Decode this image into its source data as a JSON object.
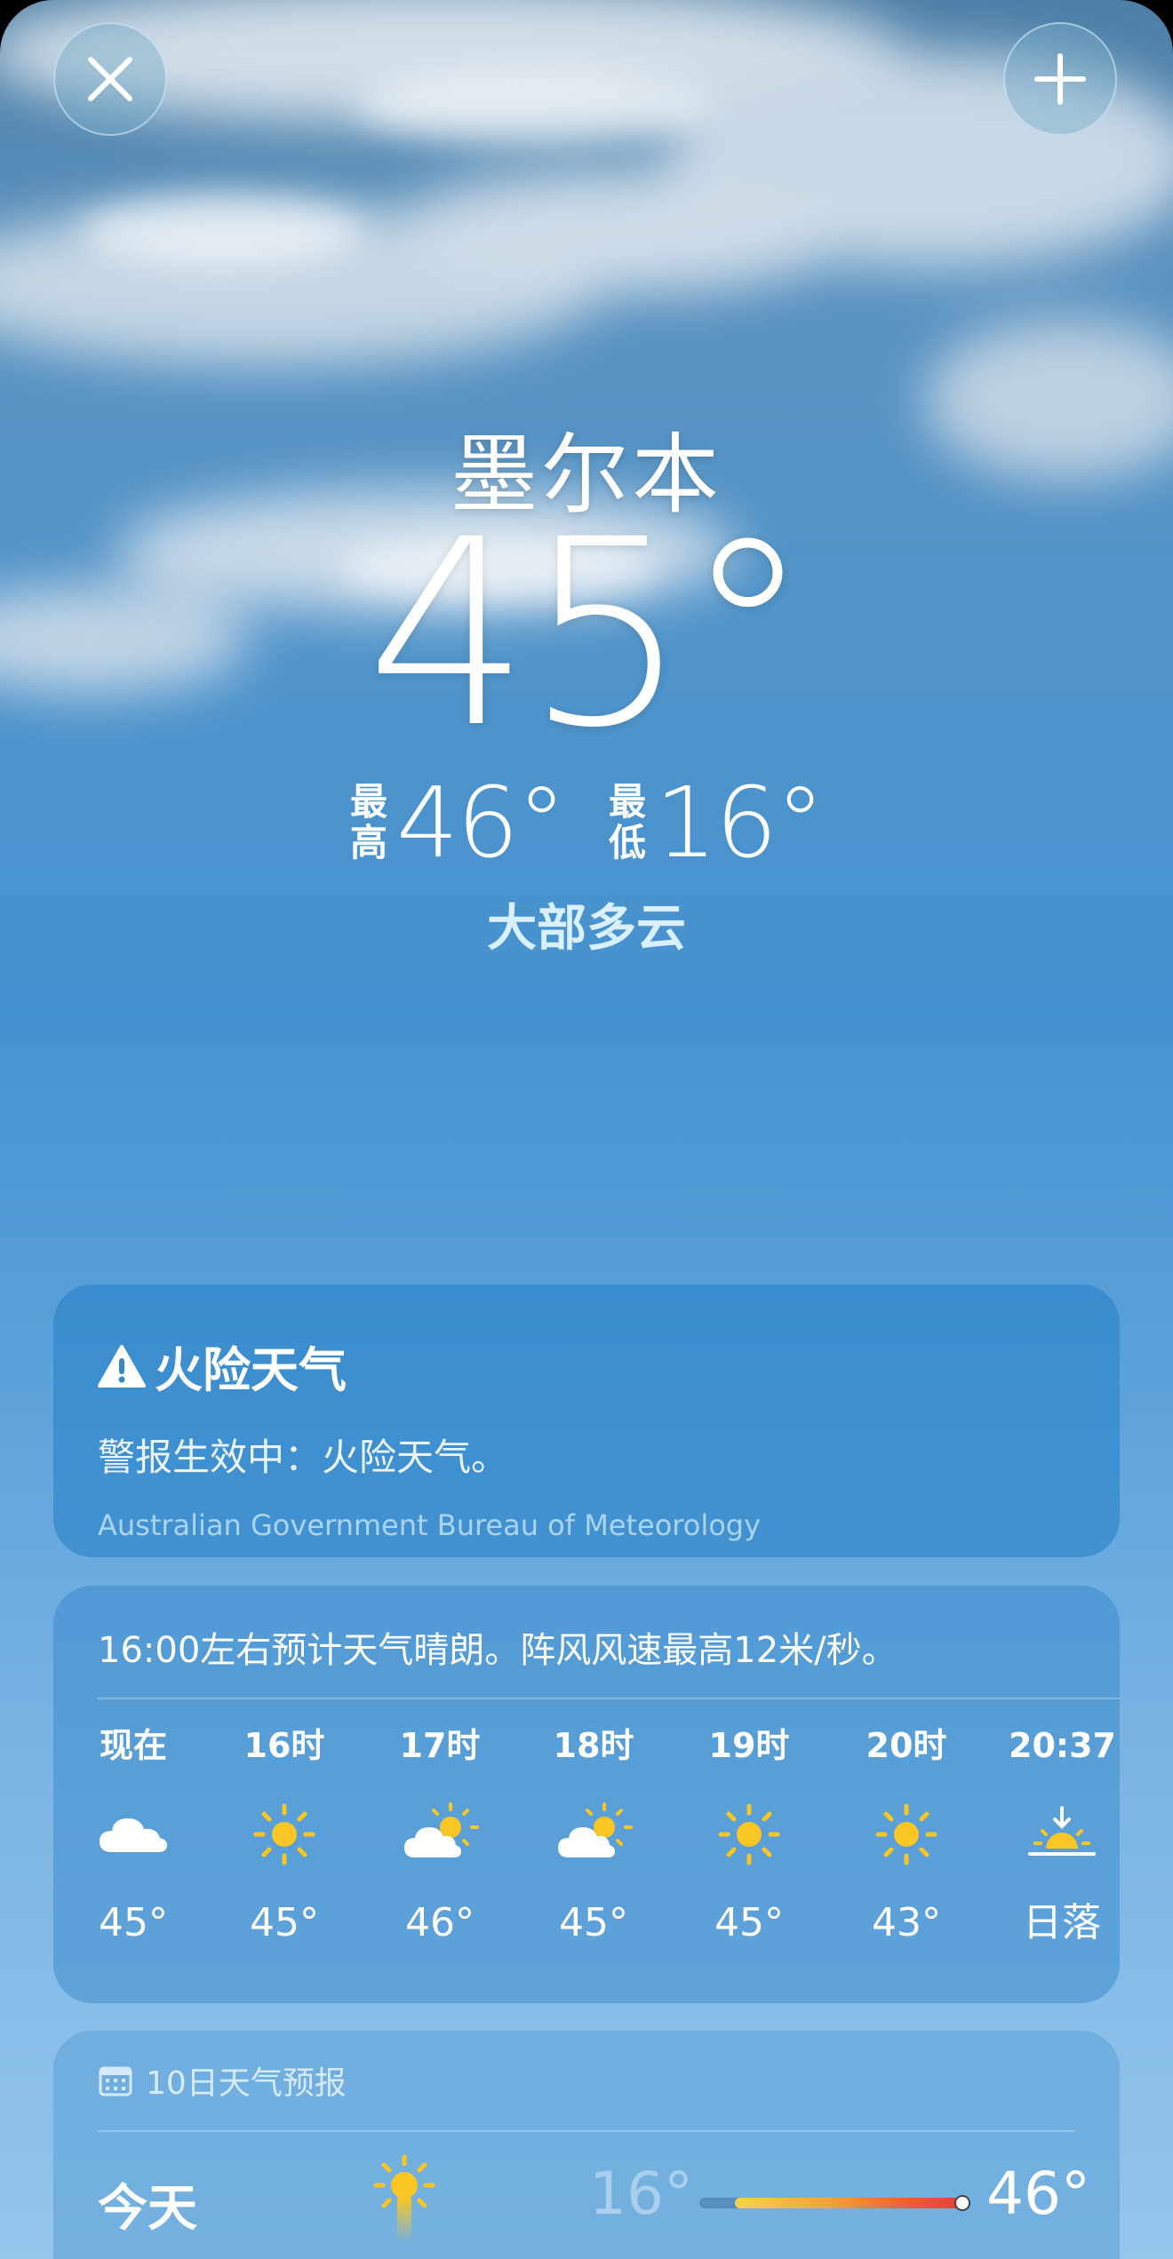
{
  "header": {
    "close_icon": "close-icon",
    "add_icon": "plus-icon"
  },
  "current": {
    "city": "墨尔本",
    "temperature": "45°",
    "high_label_1": "最",
    "high_label_2": "高",
    "high": "46°",
    "low_label_1": "最",
    "low_label_2": "低",
    "low": "16°",
    "condition": "大部多云"
  },
  "alert": {
    "icon": "warning-icon",
    "title": "火险天气",
    "description": "警报生效中：火险天气。",
    "source": "Australian Government Bureau of Meteorology"
  },
  "hourly": {
    "summary": "16:00左右预计天气晴朗。阵风风速最高12米/秒。",
    "items": [
      {
        "time": "现在",
        "icon": "cloud-icon",
        "temp": "45°"
      },
      {
        "time": "16时",
        "icon": "sun-icon",
        "temp": "45°"
      },
      {
        "time": "17时",
        "icon": "partly-cloudy-icon",
        "temp": "46°"
      },
      {
        "time": "18时",
        "icon": "partly-cloudy-icon",
        "temp": "45°"
      },
      {
        "time": "19时",
        "icon": "sun-icon",
        "temp": "45°"
      },
      {
        "time": "20时",
        "icon": "sun-icon",
        "temp": "43°"
      },
      {
        "time": "20:37",
        "icon": "sunset-icon",
        "temp": "日落"
      }
    ]
  },
  "daily": {
    "header_icon": "calendar-icon",
    "header": "10日天气预报",
    "rows": [
      {
        "day": "今天",
        "icon": "sun-icon",
        "low": "16°",
        "high": "46°",
        "current_fraction": 1.0
      }
    ]
  },
  "colors": {
    "sun": "#f9c623",
    "sky_top": "#4d7fa6",
    "sky_bottom": "#95c6ec",
    "bar_start": "#f7d34a",
    "bar_end": "#e5383b"
  }
}
